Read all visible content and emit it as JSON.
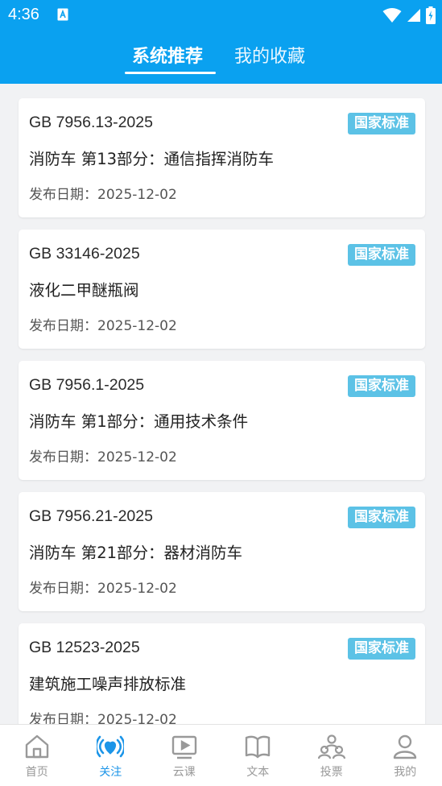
{
  "status": {
    "time": "4:36"
  },
  "tabs": {
    "recommended": "系统推荐",
    "favorites": "我的收藏"
  },
  "cards": [
    {
      "code": "GB 7956.13-2025",
      "badge": "国家标准",
      "title": "消防车 第13部分：通信指挥消防车",
      "date": "发布日期：2025-12-02"
    },
    {
      "code": "GB 33146-2025",
      "badge": "国家标准",
      "title": "液化二甲醚瓶阀",
      "date": "发布日期：2025-12-02"
    },
    {
      "code": "GB 7956.1-2025",
      "badge": "国家标准",
      "title": "消防车 第1部分：通用技术条件",
      "date": "发布日期：2025-12-02"
    },
    {
      "code": "GB 7956.21-2025",
      "badge": "国家标准",
      "title": "消防车 第21部分：器材消防车",
      "date": "发布日期：2025-12-02"
    },
    {
      "code": "GB 12523-2025",
      "badge": "国家标准",
      "title": "建筑施工噪声排放标准",
      "date": "发布日期：2025-12-02"
    }
  ],
  "nav": [
    {
      "label": "首页",
      "icon": "home-icon"
    },
    {
      "label": "关注",
      "icon": "broadcast-icon",
      "active": true
    },
    {
      "label": "云课",
      "icon": "video-icon"
    },
    {
      "label": "文本",
      "icon": "book-icon"
    },
    {
      "label": "投票",
      "icon": "group-icon"
    },
    {
      "label": "我的",
      "icon": "user-icon"
    }
  ],
  "colors": {
    "header": "#0aa1f0",
    "badge": "#5cc2e6",
    "nav_active": "#1c95e8",
    "nav_inactive": "#999999"
  }
}
